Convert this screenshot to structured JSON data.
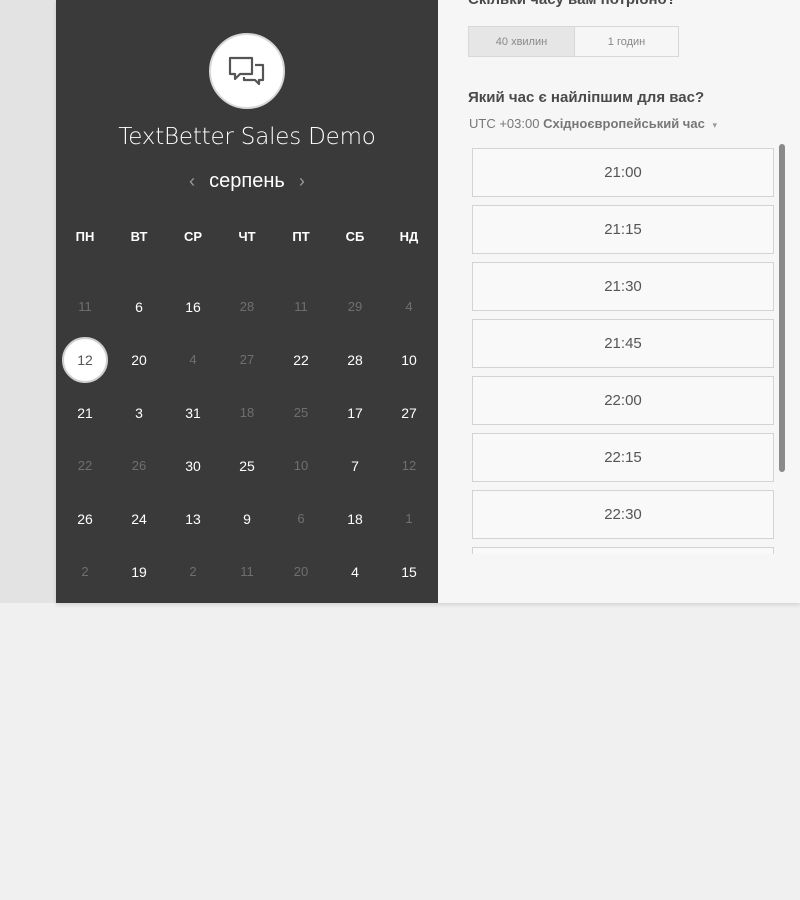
{
  "calendar": {
    "title": "TextBetter Sales Demo",
    "month": "серпень",
    "prev_arrow": "‹",
    "next_arrow": "›",
    "weekdays": [
      "ПН",
      "ВТ",
      "СР",
      "ЧТ",
      "ПТ",
      "СБ",
      "НД"
    ],
    "days": [
      {
        "label": "11",
        "active": false
      },
      {
        "label": "6",
        "active": true
      },
      {
        "label": "16",
        "active": true
      },
      {
        "label": "28",
        "active": false
      },
      {
        "label": "11",
        "active": false
      },
      {
        "label": "29",
        "active": false
      },
      {
        "label": "4",
        "active": false
      },
      {
        "label": "12",
        "active": true,
        "selected": true
      },
      {
        "label": "20",
        "active": true
      },
      {
        "label": "4",
        "active": false
      },
      {
        "label": "27",
        "active": false
      },
      {
        "label": "22",
        "active": true
      },
      {
        "label": "28",
        "active": true
      },
      {
        "label": "10",
        "active": true
      },
      {
        "label": "21",
        "active": true
      },
      {
        "label": "3",
        "active": true
      },
      {
        "label": "31",
        "active": true
      },
      {
        "label": "18",
        "active": false
      },
      {
        "label": "25",
        "active": false
      },
      {
        "label": "17",
        "active": true
      },
      {
        "label": "27",
        "active": true
      },
      {
        "label": "22",
        "active": false
      },
      {
        "label": "26",
        "active": false
      },
      {
        "label": "30",
        "active": true
      },
      {
        "label": "25",
        "active": true
      },
      {
        "label": "10",
        "active": false
      },
      {
        "label": "7",
        "active": true
      },
      {
        "label": "12",
        "active": false
      },
      {
        "label": "26",
        "active": true
      },
      {
        "label": "24",
        "active": true
      },
      {
        "label": "13",
        "active": true
      },
      {
        "label": "9",
        "active": true
      },
      {
        "label": "6",
        "active": false
      },
      {
        "label": "18",
        "active": true
      },
      {
        "label": "1",
        "active": false
      },
      {
        "label": "2",
        "active": false
      },
      {
        "label": "19",
        "active": true
      },
      {
        "label": "2",
        "active": false
      },
      {
        "label": "11",
        "active": false
      },
      {
        "label": "20",
        "active": false
      },
      {
        "label": "4",
        "active": true
      },
      {
        "label": "15",
        "active": true
      }
    ]
  },
  "duration": {
    "question": "Скільки часу вам потрібно?",
    "options": [
      "40 хвилин",
      "1 годин"
    ],
    "selected": 0
  },
  "time": {
    "question": "Який час є найліпшим для вас?",
    "tz_offset": "UTC +03:00",
    "tz_name": "Східноєвропейський час",
    "tz_caret": "▾",
    "slots": [
      "21:00",
      "21:15",
      "21:30",
      "21:45",
      "22:00",
      "22:15",
      "22:30",
      ""
    ]
  },
  "colors": {
    "calendar_bg": "#3a3a3a",
    "panel_bg": "#f6f6f6",
    "page_bg": "#f0f0f0"
  }
}
